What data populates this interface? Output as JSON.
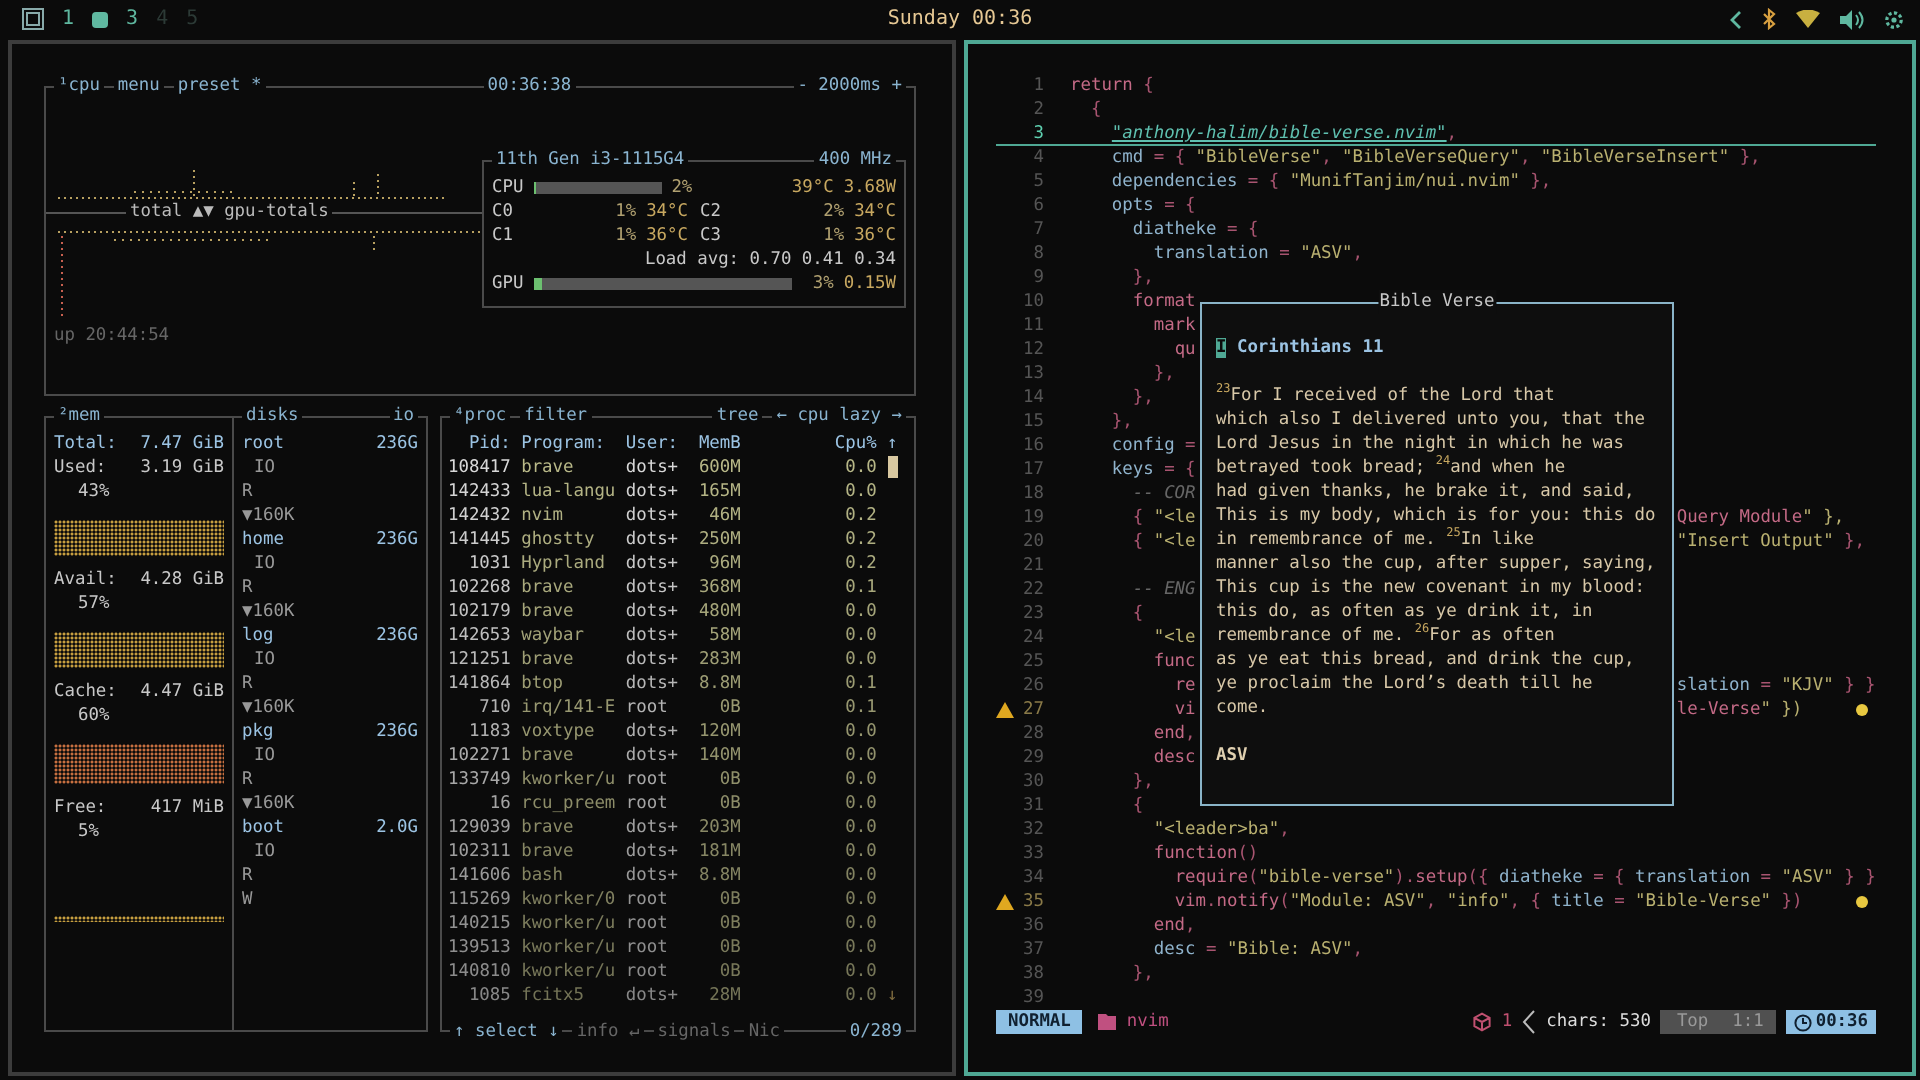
{
  "topbar": {
    "workspaces": [
      {
        "kind": "number",
        "label": "1",
        "occupied": true,
        "selected": false
      },
      {
        "kind": "dot",
        "occupied": true,
        "selected": true
      },
      {
        "kind": "number",
        "label": "3",
        "occupied": true,
        "selected": false
      },
      {
        "kind": "number",
        "label": "4",
        "occupied": false,
        "selected": false
      },
      {
        "kind": "number",
        "label": "5",
        "occupied": false,
        "selected": false
      }
    ],
    "clock": "Sunday 00:36"
  },
  "btop": {
    "cpu": {
      "titles": [
        "¹cpu",
        "menu",
        "preset *"
      ],
      "clock": "00:36:38",
      "refresh": "- 2000ms +",
      "graph_label": "total ▲▼ gpu-totals",
      "uptime": "up 20:44:54",
      "info": {
        "model": "11th Gen i3-1115G4",
        "freq": "400 MHz",
        "total": {
          "label": "CPU",
          "level": 0.02,
          "percent": "2%",
          "temp": "39°C",
          "power": "3.68W"
        },
        "cores": [
          {
            "label": "C0",
            "percent": "1%",
            "temp": "34°C"
          },
          {
            "label": "C2",
            "percent": "2%",
            "temp": "34°C"
          },
          {
            "label": "C1",
            "percent": "1%",
            "temp": "36°C"
          },
          {
            "label": "C3",
            "percent": "1%",
            "temp": "36°C"
          }
        ],
        "load": "Load avg: 0.70 0.41 0.34",
        "gpu": {
          "label": "GPU",
          "level": 0.03,
          "percent": "3%",
          "power": "0.15W"
        }
      }
    },
    "mem": {
      "title": "²mem",
      "total_label": "Total:",
      "total": "7.47 GiB",
      "items": [
        {
          "label": "Used:",
          "value": "3.19 GiB",
          "percent": "43%"
        },
        {
          "label": "Avail:",
          "value": "4.28 GiB",
          "percent": "57%"
        },
        {
          "label": "Cache:",
          "value": "4.47 GiB",
          "percent": "60%"
        },
        {
          "label": "Free:",
          "value": "417 MiB",
          "percent": "5%"
        }
      ]
    },
    "disks": {
      "title": "disks",
      "io_title": "io",
      "items": [
        {
          "name": "root",
          "size": "236G",
          "lines": [
            "IO",
            "R",
            "▼160K"
          ]
        },
        {
          "name": "home",
          "size": "236G",
          "lines": [
            "IO",
            "R",
            "▼160K"
          ]
        },
        {
          "name": "log",
          "size": "236G",
          "lines": [
            "IO",
            "R",
            "▼160K"
          ]
        },
        {
          "name": "pkg",
          "size": "236G",
          "lines": [
            "IO",
            "R",
            "▼160K"
          ]
        },
        {
          "name": "boot",
          "size": "2.0G",
          "lines": [
            "IO",
            "R",
            "W"
          ]
        }
      ]
    },
    "proc": {
      "titles": [
        "⁴proc",
        "filter"
      ],
      "right_titles": [
        "tree",
        "← cpu lazy →"
      ],
      "columns": [
        "Pid:",
        "Program:",
        "User:",
        "MemB",
        "Cpu%"
      ],
      "scroll_up": "↑",
      "scroll_down": "↓",
      "rows": [
        [
          "108417",
          "brave",
          "dots+",
          "600M",
          "0.0"
        ],
        [
          "142433",
          "lua-langu",
          "dots+",
          "165M",
          "0.0"
        ],
        [
          "142432",
          "nvim",
          "dots+",
          "46M",
          "0.2"
        ],
        [
          "141445",
          "ghostty",
          "dots+",
          "250M",
          "0.2"
        ],
        [
          "1031",
          "Hyprland",
          "dots+",
          "96M",
          "0.2"
        ],
        [
          "102268",
          "brave",
          "dots+",
          "368M",
          "0.1"
        ],
        [
          "102179",
          "brave",
          "dots+",
          "480M",
          "0.0"
        ],
        [
          "142653",
          "waybar",
          "dots+",
          "58M",
          "0.0"
        ],
        [
          "121251",
          "brave",
          "dots+",
          "283M",
          "0.0"
        ],
        [
          "141864",
          "btop",
          "dots+",
          "8.8M",
          "0.1"
        ],
        [
          "710",
          "irq/141-E",
          "root",
          "0B",
          "0.1"
        ],
        [
          "1183",
          "voxtype",
          "dots+",
          "120M",
          "0.0"
        ],
        [
          "102271",
          "brave",
          "dots+",
          "140M",
          "0.0"
        ],
        [
          "133749",
          "kworker/u",
          "root",
          "0B",
          "0.0"
        ],
        [
          "16",
          "rcu_preem",
          "root",
          "0B",
          "0.0"
        ],
        [
          "129039",
          "brave",
          "dots+",
          "203M",
          "0.0"
        ],
        [
          "102311",
          "brave",
          "dots+",
          "181M",
          "0.0"
        ],
        [
          "141606",
          "bash",
          "dots+",
          "8.8M",
          "0.0"
        ],
        [
          "115269",
          "kworker/0",
          "root",
          "0B",
          "0.0"
        ],
        [
          "140215",
          "kworker/u",
          "root",
          "0B",
          "0.0"
        ],
        [
          "139513",
          "kworker/u",
          "root",
          "0B",
          "0.0"
        ],
        [
          "140810",
          "kworker/u",
          "root",
          "0B",
          "0.0"
        ],
        [
          "1085",
          "fcitx5",
          "dots+",
          "28M",
          "0.0"
        ]
      ],
      "footer": [
        "↑ select ↓",
        "info ↵",
        "signals",
        "Nic"
      ],
      "count": "0/289"
    }
  },
  "editor": {
    "lines": [
      {
        "number": "1",
        "text": "return {",
        "current": false,
        "warning": false
      },
      {
        "number": "2",
        "text": "  {",
        "current": false,
        "warning": false
      },
      {
        "number": "3",
        "text": "    \"anthony-halim/bible-verse.nvim\",",
        "current": true,
        "warning": false
      },
      {
        "number": "4",
        "text": "    cmd = { \"BibleVerse\", \"BibleVerseQuery\", \"BibleVerseInsert\" },",
        "current": false,
        "warning": false
      },
      {
        "number": "5",
        "text": "    dependencies = { \"MunifTanjim/nui.nvim\" },",
        "current": false,
        "warning": false
      },
      {
        "number": "6",
        "text": "    opts = {",
        "current": false,
        "warning": false
      },
      {
        "number": "7",
        "text": "      diatheke = {",
        "current": false,
        "warning": false
      },
      {
        "number": "8",
        "text": "        translation = \"ASV\",",
        "current": false,
        "warning": false
      },
      {
        "number": "9",
        "text": "      },",
        "current": false,
        "warning": false
      },
      {
        "number": "10",
        "text": "      format",
        "current": false,
        "warning": false
      },
      {
        "number": "11",
        "text": "        mark",
        "current": false,
        "warning": false
      },
      {
        "number": "12",
        "text": "          qu",
        "current": false,
        "warning": false
      },
      {
        "number": "13",
        "text": "        },",
        "current": false,
        "warning": false
      },
      {
        "number": "14",
        "text": "      },",
        "current": false,
        "warning": false
      },
      {
        "number": "15",
        "text": "    },",
        "current": false,
        "warning": false
      },
      {
        "number": "16",
        "text": "    config =",
        "current": false,
        "warning": false
      },
      {
        "number": "17",
        "text": "    keys = {",
        "current": false,
        "warning": false
      },
      {
        "number": "18",
        "text": "      -- COR",
        "current": false,
        "warning": false
      },
      {
        "number": "19",
        "text": "      { \"<le",
        "tail": "Query Module\" },",
        "current": false,
        "warning": false
      },
      {
        "number": "20",
        "text": "      { \"<le",
        "tail": "\"Insert Output\" },",
        "current": false,
        "warning": false
      },
      {
        "number": "21",
        "current": false,
        "warning": false
      },
      {
        "number": "22",
        "text": "      -- ENG",
        "current": false,
        "warning": false
      },
      {
        "number": "23",
        "text": "      {",
        "current": false,
        "warning": false
      },
      {
        "number": "24",
        "text": "        \"<le",
        "current": false,
        "warning": false
      },
      {
        "number": "25",
        "text": "        func",
        "current": false,
        "warning": false
      },
      {
        "number": "26",
        "text": "          re",
        "tail": "slation = \"KJV\" } }",
        "current": false,
        "warning": false
      },
      {
        "number": "27",
        "text": "          vi",
        "tail": "le-Verse\" })",
        "current": false,
        "warning": true
      },
      {
        "number": "28",
        "text": "        end,",
        "current": false,
        "warning": false
      },
      {
        "number": "29",
        "text": "        desc",
        "current": false,
        "warning": false
      },
      {
        "number": "30",
        "text": "      },",
        "current": false,
        "warning": false
      },
      {
        "number": "31",
        "text": "      {",
        "current": false,
        "warning": false
      },
      {
        "number": "32",
        "text": "        \"<leader>ba\",",
        "current": false,
        "warning": false
      },
      {
        "number": "33",
        "text": "        function()",
        "current": false,
        "warning": false
      },
      {
        "number": "34",
        "text": "          require(\"bible-verse\").setup({ diatheke = { translation = \"ASV\" } }",
        "current": false,
        "warning": false
      },
      {
        "number": "35",
        "text": "          vim.notify(\"Module: ASV\", \"info\", { title = \"Bible-Verse\" })",
        "current": false,
        "warning": true
      },
      {
        "number": "36",
        "text": "        end,",
        "current": false,
        "warning": false
      },
      {
        "number": "37",
        "text": "        desc = \"Bible: ASV\",",
        "current": false,
        "warning": false
      },
      {
        "number": "38",
        "text": "      },",
        "current": false,
        "warning": false
      },
      {
        "number": "39",
        "current": false,
        "warning": false
      }
    ],
    "popup": {
      "title": "Bible Verse",
      "heading": "I Corinthians 11",
      "body": [
        "$^{23}$For I received of the Lord that",
        "which also I delivered unto you, that the",
        "Lord Jesus in the night in which he was",
        "betrayed took bread; $^{24}$and when he",
        "had given thanks, he brake it, and said,",
        "This is my body, which is for you: this do",
        "in remembrance of me. $^{25}$In like",
        "manner also the cup, after supper, saying,",
        "This cup is the new covenant in my blood:",
        "this do, as often as ye drink it, in",
        "remembrance of me. $^{26}$For as often",
        "as ye eat this bread, and drink the cup,",
        "ye proclaim the Lord’s death till he",
        "come."
      ],
      "translation": "ASV"
    },
    "statusline": {
      "mode": "NORMAL",
      "file": "nvim",
      "changes": "1",
      "chars": "chars: 530",
      "position": "Top",
      "cursor": "1:1",
      "time": "00:36"
    }
  }
}
